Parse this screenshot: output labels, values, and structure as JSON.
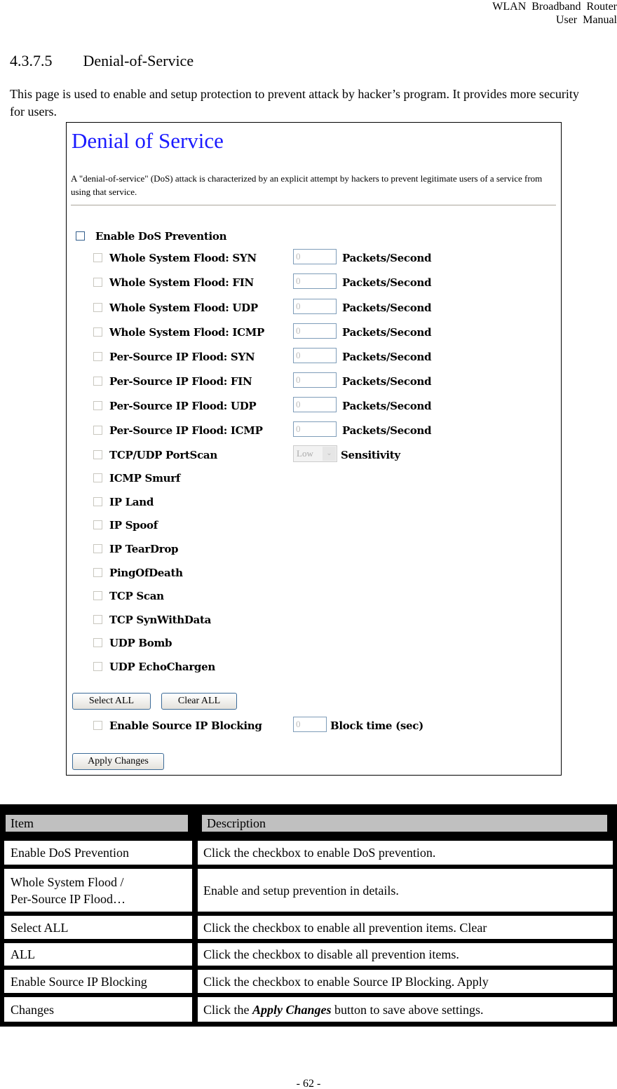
{
  "header": {
    "line1": "WLAN  Broadband  Router",
    "line2": "User  Manual"
  },
  "section": {
    "number": "4.3.7.5",
    "title": "Denial-of-Service"
  },
  "intro": "This page is used to enable and setup protection to prevent attack by hacker’s program. It provides more security for users.",
  "screenshot": {
    "title": "Denial of Service",
    "description": "A \"denial-of-service\" (DoS) attack is characterized by an explicit attempt by hackers to prevent legitimate users of a service from using that service.",
    "title_color": "#1a1aff",
    "enable_dos": {
      "label": "Enable DoS Prevention",
      "checked": false
    },
    "items": [
      {
        "label": "Whole System Flood: SYN",
        "value": "0",
        "unit": "Packets/Second"
      },
      {
        "label": "Whole System Flood: FIN",
        "value": "0",
        "unit": "Packets/Second"
      },
      {
        "label": "Whole System Flood: UDP",
        "value": "0",
        "unit": "Packets/Second"
      },
      {
        "label": "Whole System Flood: ICMP",
        "value": "0",
        "unit": "Packets/Second"
      },
      {
        "label": "Per-Source IP Flood: SYN",
        "value": "0",
        "unit": "Packets/Second"
      },
      {
        "label": "Per-Source IP Flood: FIN",
        "value": "0",
        "unit": "Packets/Second"
      },
      {
        "label": "Per-Source IP Flood: UDP",
        "value": "0",
        "unit": "Packets/Second"
      },
      {
        "label": "Per-Source IP Flood: ICMP",
        "value": "0",
        "unit": "Packets/Second"
      },
      {
        "label": "TCP/UDP PortScan",
        "select": "Low",
        "unit": "Sensitivity"
      },
      {
        "label": "ICMP Smurf"
      },
      {
        "label": "IP Land"
      },
      {
        "label": "IP Spoof"
      },
      {
        "label": "IP TearDrop"
      },
      {
        "label": "PingOfDeath"
      },
      {
        "label": "TCP Scan"
      },
      {
        "label": "TCP SynWithData"
      },
      {
        "label": "UDP Bomb"
      },
      {
        "label": "UDP EchoChargen"
      }
    ],
    "select_all": "Select ALL",
    "clear_all": "Clear ALL",
    "source_ip": {
      "label": "Enable Source IP Blocking",
      "value": "0",
      "unit": "Block time (sec)"
    },
    "apply": "Apply Changes"
  },
  "table": {
    "headers": [
      "Item",
      "Description"
    ],
    "rows": [
      {
        "item": "Enable DoS Prevention",
        "desc": "Click the checkbox to enable DoS prevention."
      },
      {
        "item": "Whole System Flood /",
        "item2": "Per-Source IP Flood…",
        "desc": "Enable and setup prevention in details."
      },
      {
        "item": "Select ALL",
        "desc": "Click the checkbox to enable all prevention items. Clear"
      },
      {
        "item": "ALL",
        "desc": "Click the checkbox to disable all prevention items."
      },
      {
        "item": "Enable Source IP Blocking",
        "desc": "Click the checkbox to enable Source IP Blocking. Apply"
      },
      {
        "item": "Changes",
        "desc_pre": "Click the ",
        "desc_em": "Apply Changes",
        "desc_post": " button to save above settings."
      }
    ]
  },
  "footer": "- 62 -"
}
